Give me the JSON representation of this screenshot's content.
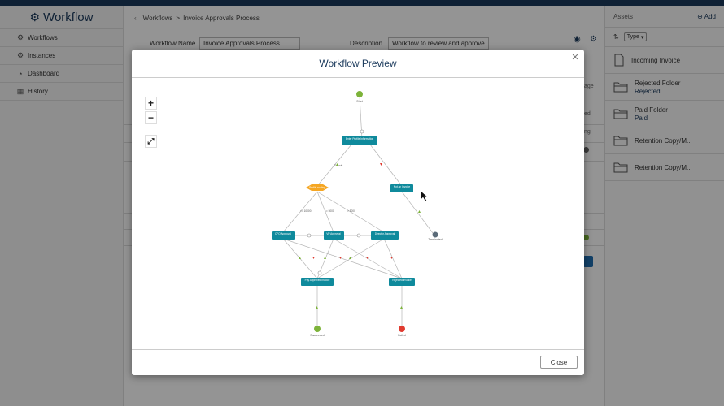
{
  "app": {
    "title": "Workflow"
  },
  "sidebar": {
    "items": [
      {
        "label": "Workflows",
        "icon": "gears-icon"
      },
      {
        "label": "Instances",
        "icon": "gear-icon"
      },
      {
        "label": "Dashboard",
        "icon": "dashboard-icon"
      },
      {
        "label": "History",
        "icon": "calendar-icon"
      }
    ]
  },
  "breadcrumb": {
    "root": "Workflows",
    "separator": ">",
    "current": "Invoice Approvals Process"
  },
  "form": {
    "name_label": "Workflow Name",
    "name_value": "Invoice Approvals Process",
    "desc_label": "Description",
    "desc_value": "Workflow to review and approve"
  },
  "background_fragments": [
    "age",
    "ed",
    "ng"
  ],
  "assets": {
    "title": "Assets",
    "add_label": "Add",
    "type_label": "Type",
    "items": [
      {
        "name": "Incoming Invoice",
        "sub": "",
        "icon": "file-icon"
      },
      {
        "name": "Rejected Folder",
        "sub": "Rejected",
        "icon": "folder-icon"
      },
      {
        "name": "Paid Folder",
        "sub": "Paid",
        "icon": "folder-icon"
      },
      {
        "name": "Retention Copy/M...",
        "sub": "",
        "icon": "folder-icon"
      },
      {
        "name": "Retention Copy/M...",
        "sub": "",
        "icon": "folder-icon"
      }
    ]
  },
  "modal": {
    "title": "Workflow Preview",
    "close_label": "Close",
    "zoom_in": "+",
    "zoom_out": "−",
    "fit": "⤢"
  },
  "graph": {
    "colors": {
      "task": "#0f8a9c",
      "start": "#7db33a",
      "end_ok": "#7db33a",
      "end_fail": "#e03a2f",
      "end_term": "#5a6a78",
      "decision": "#f5a623",
      "approve": "#7db33a",
      "reject": "#e03a2f"
    },
    "labels": {
      "start": "Start",
      "enter_info": "Enter Profile Information",
      "default": "Default",
      "decision": "Profile routing",
      "not_an_invoice": "Not an Invoice",
      "terminated": "Terminated",
      "branch_low": "<= 10000",
      "branch_mid": "<= 5000",
      "branch_high": "> 5000",
      "cfo": "CFO Approval",
      "vp": "VP Approval",
      "director": "Director Approval",
      "pay": "Pay Approved Invoice",
      "reject": "Rejected Invoice",
      "succeeded": "Succeeded",
      "failed": "Failed"
    }
  }
}
